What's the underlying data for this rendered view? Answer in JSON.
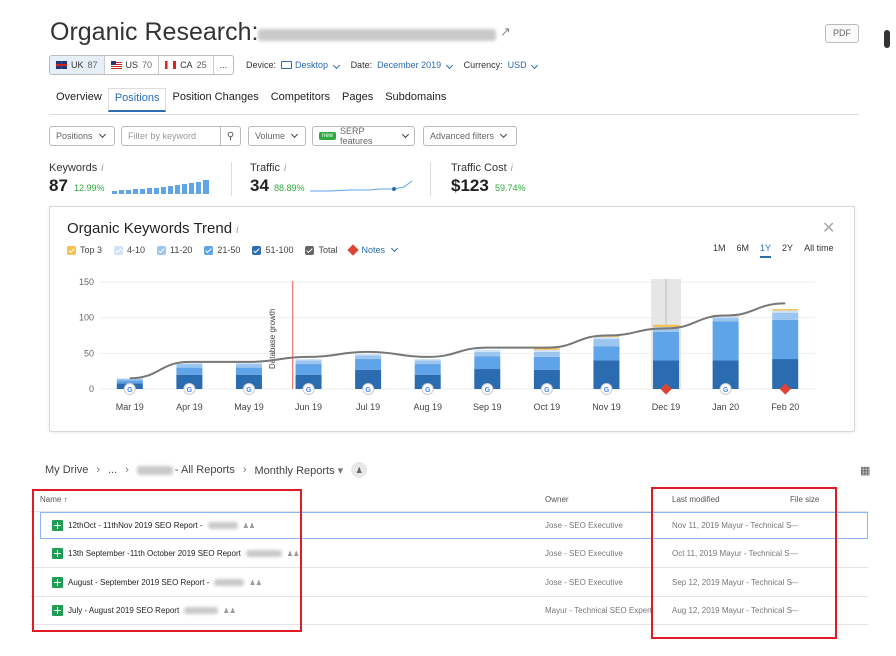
{
  "header": {
    "title": "Organic Research:",
    "pdf_label": "PDF"
  },
  "databases": [
    {
      "code": "UK",
      "count": "87"
    },
    {
      "code": "US",
      "count": "70"
    },
    {
      "code": "CA",
      "count": "25"
    }
  ],
  "databases_more": "...",
  "filters_line": {
    "device_label": "Device:",
    "device_value": "Desktop",
    "date_label": "Date:",
    "date_value": "December 2019",
    "currency_label": "Currency:",
    "currency_value": "USD"
  },
  "tabs": [
    "Overview",
    "Positions",
    "Position Changes",
    "Competitors",
    "Pages",
    "Subdomains"
  ],
  "active_tab": "Positions",
  "filter_bar": {
    "positions": "Positions",
    "search_placeholder": "Filter by keyword",
    "volume": "Volume",
    "new_badge": "new",
    "serp": "SERP features",
    "advanced": "Advanced filters"
  },
  "metrics": {
    "keywords": {
      "label": "Keywords",
      "value": "87",
      "change": "12.99%"
    },
    "traffic": {
      "label": "Traffic",
      "value": "34",
      "change": "88.89%"
    },
    "traffic_cost": {
      "label": "Traffic Cost",
      "value": "$123",
      "change": "59.74%"
    }
  },
  "trend": {
    "title": "Organic Keywords Trend",
    "legend": [
      {
        "label": "Top 3",
        "color": "#f2c14e"
      },
      {
        "label": "4-10",
        "color": "#cfe2f8"
      },
      {
        "label": "11-20",
        "color": "#9cc6f0"
      },
      {
        "label": "21-50",
        "color": "#5fa3e8"
      },
      {
        "label": "51-100",
        "color": "#2b6cb0"
      },
      {
        "label": "Total",
        "color": "#666666"
      }
    ],
    "notes_label": "Notes",
    "ranges": [
      "1M",
      "6M",
      "1Y",
      "2Y",
      "All time"
    ],
    "active_range": "1Y",
    "annotation": "Database growth"
  },
  "chart_data": {
    "type": "bar",
    "categories": [
      "Mar 19",
      "Apr 19",
      "May 19",
      "Jun 19",
      "Jul 19",
      "Aug 19",
      "Sep 19",
      "Oct 19",
      "Nov 19",
      "Dec 19",
      "Jan 20",
      "Feb 20"
    ],
    "series": [
      {
        "name": "51-100",
        "values": [
          8,
          20,
          20,
          20,
          27,
          20,
          28,
          27,
          40,
          40,
          40,
          42
        ]
      },
      {
        "name": "21-50",
        "values": [
          4,
          10,
          10,
          15,
          15,
          15,
          18,
          18,
          20,
          40,
          55,
          55
        ]
      },
      {
        "name": "11-20",
        "values": [
          2,
          5,
          5,
          5,
          5,
          5,
          6,
          7,
          10,
          5,
          5,
          10
        ]
      },
      {
        "name": "4-10",
        "values": [
          1,
          2,
          2,
          2,
          2,
          2,
          3,
          3,
          3,
          2,
          2,
          3
        ]
      },
      {
        "name": "Top 3",
        "values": [
          0,
          0,
          0,
          0,
          0,
          0,
          0,
          2,
          2,
          3,
          2,
          2
        ]
      },
      {
        "name": "Total",
        "values": [
          15,
          38,
          38,
          45,
          52,
          45,
          58,
          58,
          75,
          85,
          103,
          120
        ]
      }
    ],
    "ylim": [
      0,
      150
    ],
    "yticks": [
      0,
      50,
      100,
      150
    ],
    "highlight": "Dec 19",
    "note_markers": [
      "Dec 19",
      "Feb 20"
    ]
  },
  "drive": {
    "root": "My Drive",
    "dots": "...",
    "crumb": "- All Reports",
    "folder": "Monthly Reports"
  },
  "table": {
    "col_name": "Name",
    "col_owner": "Owner",
    "col_modified": "Last modified",
    "col_size": "File size",
    "rows": [
      {
        "name": "12thOct - 11thNov 2019 SEO Report -",
        "owner": "Jose - SEO Executive",
        "modified": "Nov 11, 2019 Mayur - Technical S",
        "size": "—"
      },
      {
        "name": "13th September -11th October 2019 SEO Report",
        "owner": "Jose - SEO Executive",
        "modified": "Oct 11, 2019 Mayur - Technical S",
        "size": "—"
      },
      {
        "name": "August - September 2019 SEO Report -",
        "owner": "Jose - SEO Executive",
        "modified": "Sep 12, 2019 Mayur - Technical S",
        "size": "—"
      },
      {
        "name": "July - August 2019 SEO Report",
        "owner": "Mayur - Technical SEO Expert",
        "modified": "Aug 12, 2019 Mayur - Technical S",
        "size": "—"
      }
    ]
  }
}
